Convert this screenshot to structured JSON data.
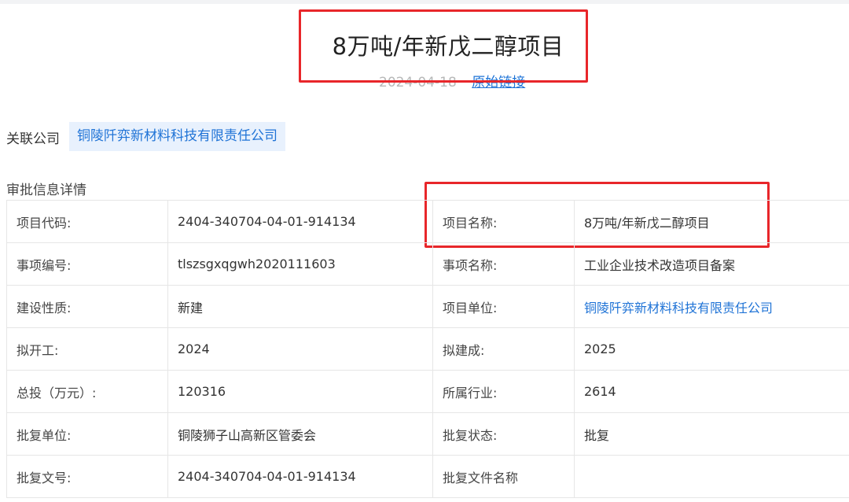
{
  "header": {
    "title": "8万吨/年新戊二醇项目",
    "date": "2024-04-18",
    "source_link": "原始链接"
  },
  "related": {
    "label": "关联公司",
    "company": "铜陵阡弈新材料科技有限责任公司"
  },
  "section": {
    "title": "审批信息详情"
  },
  "rows": [
    {
      "l1": "项目代码:",
      "v1": "2404-340704-04-01-914134",
      "l2": "项目名称:",
      "v2": "8万吨/年新戊二醇项目"
    },
    {
      "l1": "事项编号:",
      "v1": "tlszsgxqgwh2020111603",
      "l2": "事项名称:",
      "v2": "工业企业技术改造项目备案"
    },
    {
      "l1": "建设性质:",
      "v1": "新建",
      "l2": "项目单位:",
      "v2": "铜陵阡弈新材料科技有限责任公司"
    },
    {
      "l1": "拟开工:",
      "v1": "2024",
      "l2": "拟建成:",
      "v2": "2025"
    },
    {
      "l1": "总投（万元）:",
      "v1": "120316",
      "l2": "所属行业:",
      "v2": "2614"
    },
    {
      "l1": "批复单位:",
      "v1": "铜陵狮子山高新区管委会",
      "l2": "批复状态:",
      "v2": "批复"
    },
    {
      "l1": "批复文号:",
      "v1": "2404-340704-04-01-914134",
      "l2": "批复文件名称",
      "v2": ""
    }
  ],
  "colors": {
    "link": "#1f73d6",
    "annotation": "#e8262a",
    "tag_bg": "#e8f1fd"
  }
}
